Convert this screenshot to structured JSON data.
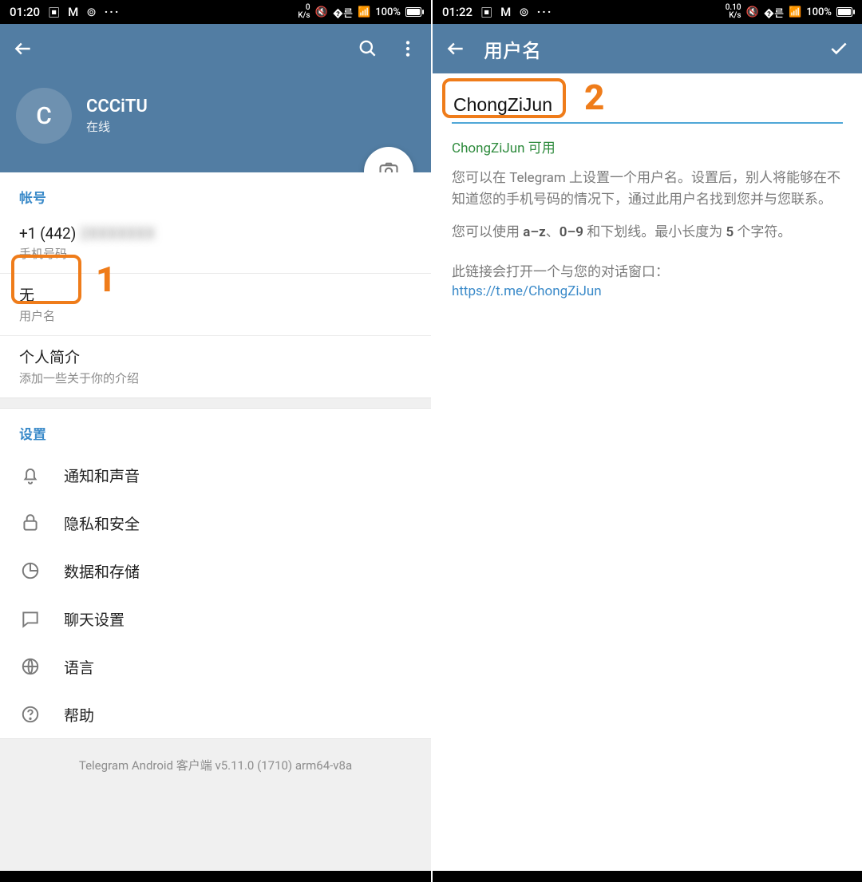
{
  "colors": {
    "accent": "#527da3",
    "link": "#3a8ac9",
    "annot": "#ef7c1a",
    "ok": "#2e8b3d"
  },
  "screen1": {
    "statusbar": {
      "time": "01:20",
      "speed": "0\nK/s",
      "net": "4G",
      "battery": "100%"
    },
    "profile": {
      "avatar_letter": "C",
      "name": "CCCiTU",
      "status": "在线"
    },
    "account": {
      "header": "帐号",
      "phone_prefix": "+1 (442)",
      "phone_blur": "2XXXXXXX",
      "phone_sub": "手机号码",
      "username_value": "无",
      "username_sub": "用户名",
      "bio_value": "个人简介",
      "bio_sub": "添加一些关于你的介绍"
    },
    "settings": {
      "header": "设置",
      "items": [
        "通知和声音",
        "隐私和安全",
        "数据和存储",
        "聊天设置",
        "语言",
        "帮助"
      ]
    },
    "footer": "Telegram Android 客户端 v5.11.0 (1710) arm64-v8a",
    "annot_num": "1"
  },
  "screen2": {
    "statusbar": {
      "time": "01:22",
      "speed": "0.10\nK/s",
      "net": "4G",
      "battery": "100%"
    },
    "title": "用户名",
    "input_value": "ChongZiJun",
    "available": "ChongZiJun 可用",
    "desc1": "您可以在 Telegram 上设置一个用户名。设置后，别人将能够在不知道您的手机号码的情况下，通过此用户名找到您并与您联系。",
    "desc2_pre": "您可以使用 ",
    "desc2_b1": "a–z",
    "desc2_mid1": "、",
    "desc2_b2": "0–9",
    "desc2_mid2": " 和下划线。最小长度为 ",
    "desc2_b3": "5",
    "desc2_end": " 个字符。",
    "link_line": "此链接会打开一个与您的对话窗口：",
    "link": "https://t.me/ChongZiJun",
    "annot_num": "2"
  }
}
